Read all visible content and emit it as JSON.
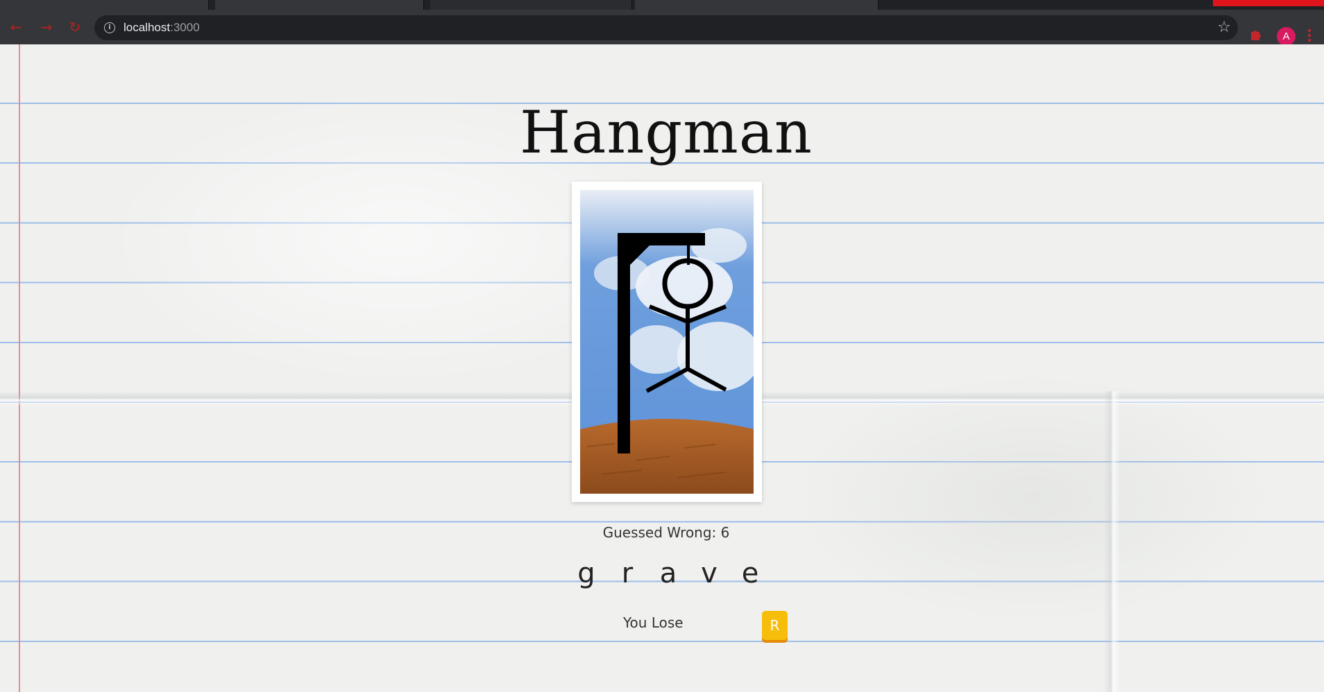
{
  "browser": {
    "url_host": "localhost",
    "url_port": ":3000",
    "avatar_initial": "A",
    "accent_color": "#d81b60"
  },
  "icons": {
    "back": "back-arrow-icon",
    "forward": "forward-arrow-icon",
    "reload": "reload-icon",
    "info": "info-icon",
    "bookmark": "star-icon",
    "extension": "extension-puzzle-icon",
    "menu": "kebab-menu-icon"
  },
  "game": {
    "title": "Hangman",
    "wrong_count_text": "Guessed Wrong: 6",
    "wrong_guesses": 6,
    "word_letters": [
      "g",
      "r",
      "a",
      "v",
      "e"
    ],
    "status_text": "You Lose",
    "reset_label": "R",
    "button_color": "#f6bd0b"
  }
}
